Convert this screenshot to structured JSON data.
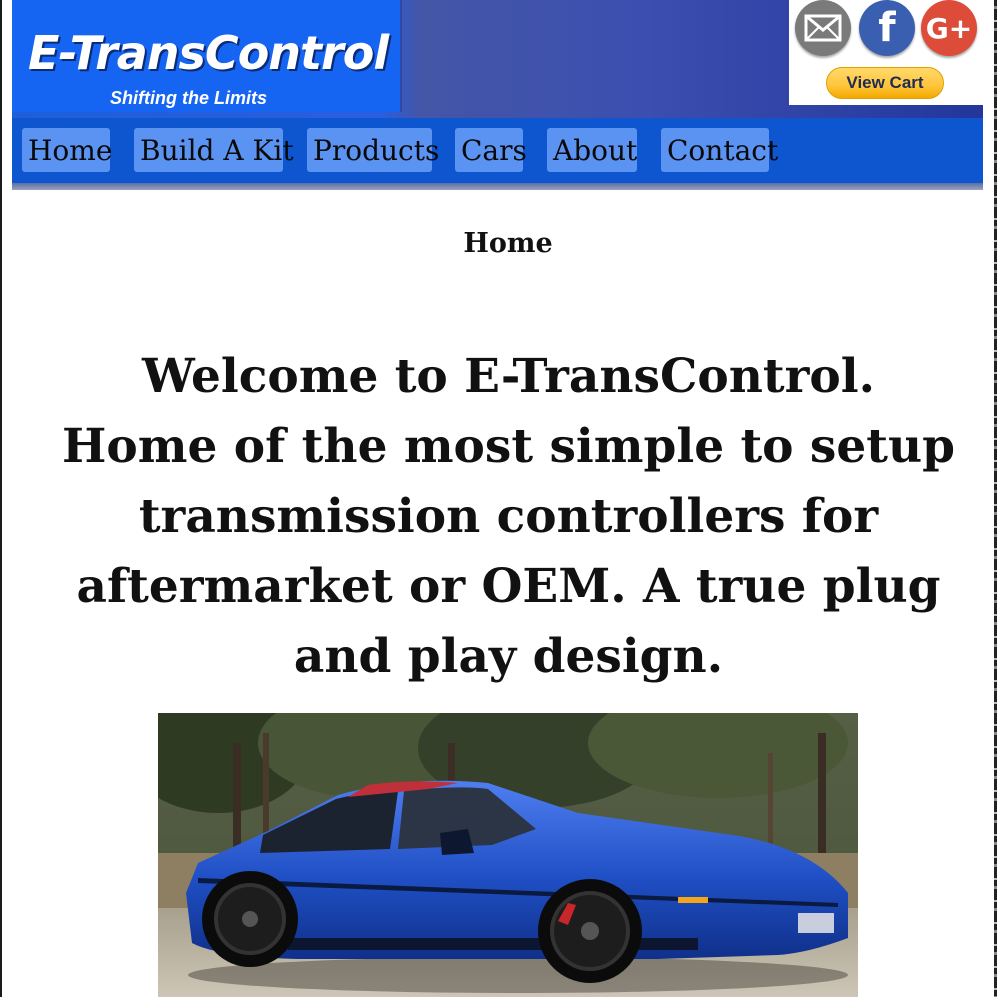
{
  "header": {
    "logo_text": "E-TransControl",
    "tagline": "Shifting the Limits",
    "social": {
      "mail_icon": "envelope-icon",
      "facebook_icon": "facebook-icon",
      "facebook_glyph": "f",
      "google_plus_icon": "google-plus-icon",
      "google_plus_glyph": "G+"
    },
    "view_cart_label": "View Cart"
  },
  "nav": {
    "items": [
      {
        "label": "Home"
      },
      {
        "label": "Build A Kit"
      },
      {
        "label": "Products"
      },
      {
        "label": "Cars"
      },
      {
        "label": "About"
      },
      {
        "label": "Contact"
      }
    ]
  },
  "main": {
    "page_title": "Home",
    "welcome_text": "Welcome to E-TransControl. Home of the most simple to setup transmission controllers for aftermarket or OEM. A true plug and play design."
  },
  "colors": {
    "header_blue": "#1565f2",
    "nav_blue": "#0e55d0",
    "nav_item": "#5b93f2",
    "car_blue": "#1f4fc4",
    "cart_yellow": "#ffc53a"
  }
}
